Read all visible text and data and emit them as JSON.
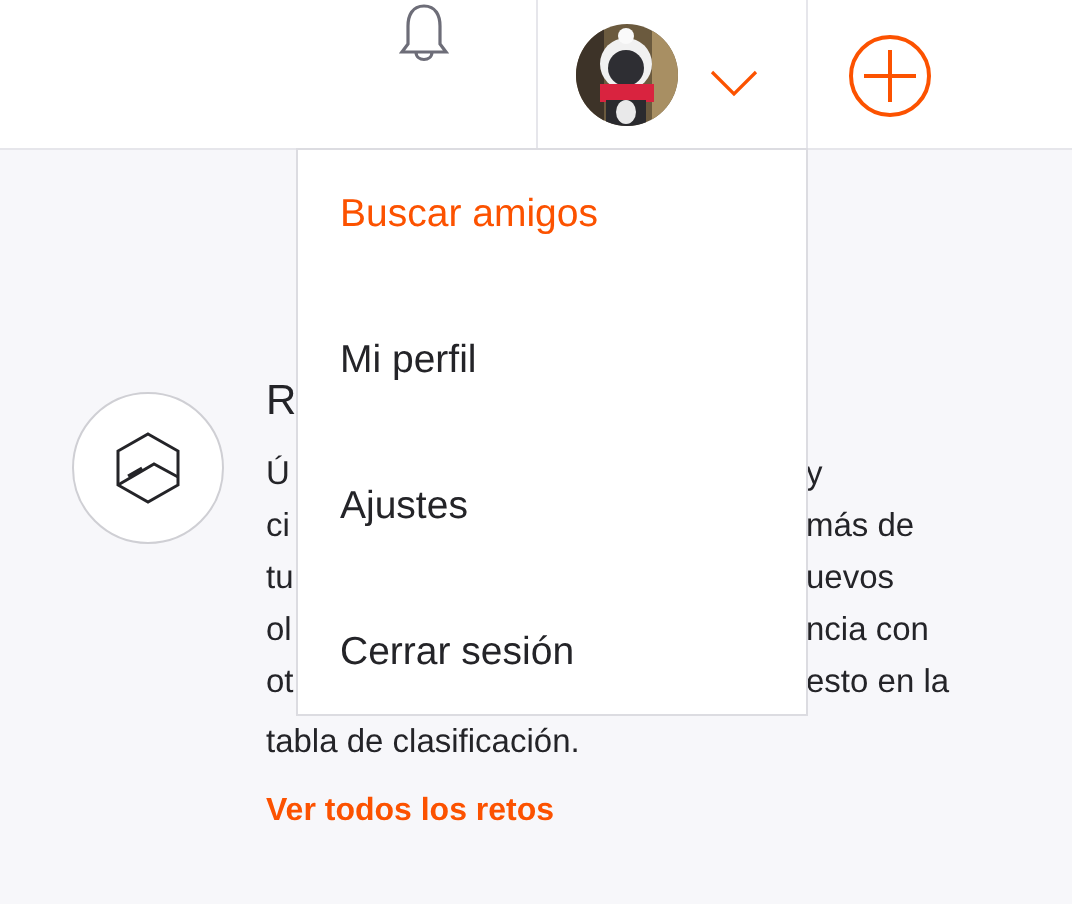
{
  "menu": {
    "items": [
      {
        "label": "Buscar amigos",
        "selected": true
      },
      {
        "label": "Mi perfil",
        "selected": false
      },
      {
        "label": "Ajustes",
        "selected": false
      },
      {
        "label": "Cerrar sesión",
        "selected": false
      }
    ]
  },
  "challenges": {
    "title": "R",
    "lines": [
      {
        "left": "Ú",
        "right": "y"
      },
      {
        "left": "ci",
        "right": "más de"
      },
      {
        "left": "tu",
        "right": "uevos"
      },
      {
        "left": "ol",
        "right": "ncia con"
      },
      {
        "left": "ot",
        "right": "esto en la"
      },
      {
        "left": "tabla de clasificación."
      }
    ],
    "link": "Ver todos los retos"
  }
}
